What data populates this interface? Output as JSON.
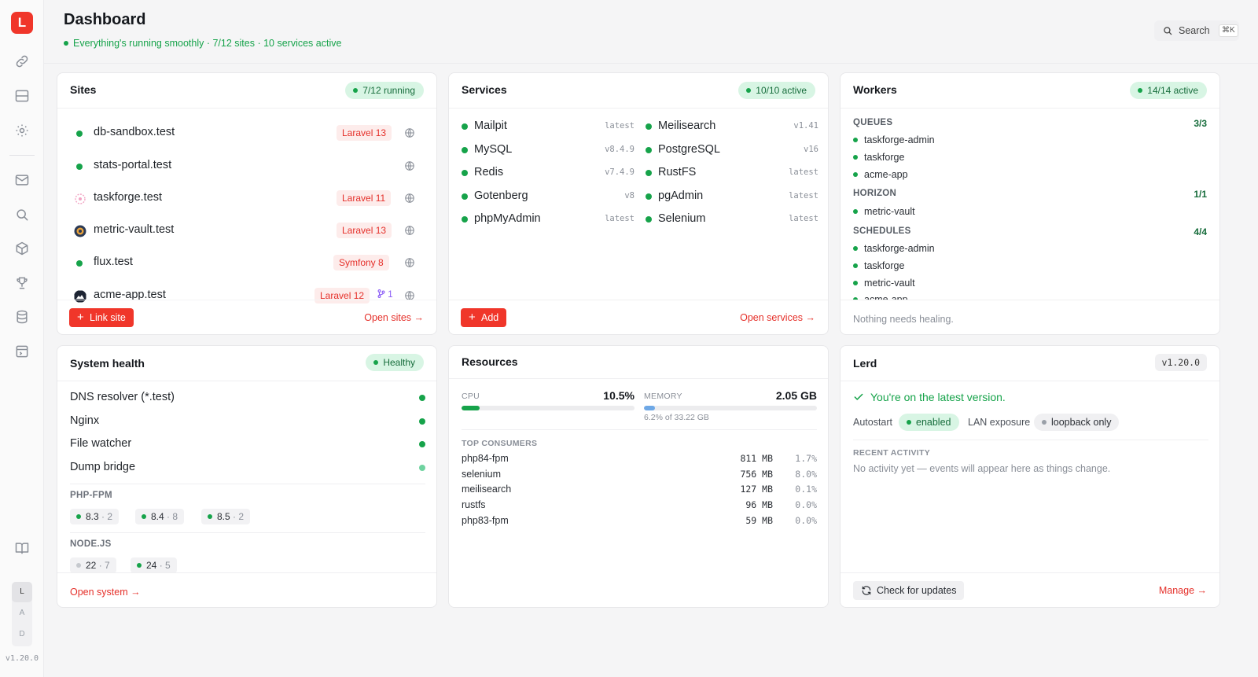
{
  "sidebar": {
    "logo": "L",
    "modes": [
      "L",
      "A",
      "D"
    ],
    "version": "v1.20.0"
  },
  "header": {
    "title": "Dashboard",
    "status": "Everything's running smoothly · 7/12 sites · 10 services active",
    "search_label": "Search",
    "search_shortcut": "⌘K"
  },
  "sites": {
    "title": "Sites",
    "badge": "7/12 running",
    "items": [
      {
        "name": "db-sandbox.test",
        "framework": "Laravel 13",
        "icon": "status-dot"
      },
      {
        "name": "stats-portal.test",
        "framework": "",
        "icon": "status-dot"
      },
      {
        "name": "taskforge.test",
        "framework": "Laravel 11",
        "icon": "taskforge-favicon"
      },
      {
        "name": "metric-vault.test",
        "framework": "Laravel 13",
        "icon": "metric-vault-favicon"
      },
      {
        "name": "flux.test",
        "framework": "Symfony 8",
        "icon": "status-dot"
      },
      {
        "name": "acme-app.test",
        "framework": "Laravel 12",
        "branches": "1",
        "icon": "acme-favicon"
      }
    ],
    "add_label": "Link site",
    "open_label": "Open sites →"
  },
  "services": {
    "title": "Services",
    "badge": "10/10 active",
    "left": [
      {
        "name": "Mailpit",
        "version": "latest"
      },
      {
        "name": "MySQL",
        "version": "v8.4.9"
      },
      {
        "name": "Redis",
        "version": "v7.4.9"
      },
      {
        "name": "Gotenberg",
        "version": "v8"
      },
      {
        "name": "phpMyAdmin",
        "version": "latest"
      }
    ],
    "right": [
      {
        "name": "Meilisearch",
        "version": "v1.41"
      },
      {
        "name": "PostgreSQL",
        "version": "v16"
      },
      {
        "name": "RustFS",
        "version": "latest"
      },
      {
        "name": "pgAdmin",
        "version": "latest"
      },
      {
        "name": "Selenium",
        "version": "latest"
      }
    ],
    "add_label": "Add",
    "open_label": "Open services →"
  },
  "workers": {
    "title": "Workers",
    "badge": "14/14 active",
    "queues": {
      "label": "QUEUES",
      "count": "3/3",
      "items": [
        "taskforge-admin",
        "taskforge",
        "acme-app"
      ]
    },
    "horizon": {
      "label": "HORIZON",
      "count": "1/1",
      "items": [
        "metric-vault"
      ]
    },
    "schedules": {
      "label": "SCHEDULES",
      "count": "4/4",
      "items": [
        "taskforge-admin",
        "taskforge",
        "metric-vault",
        "acme-app"
      ]
    },
    "footer": "Nothing needs healing."
  },
  "health": {
    "title": "System health",
    "badge": "Healthy",
    "checks": [
      {
        "name": "DNS resolver (*.test)",
        "color": "#16a34a"
      },
      {
        "name": "Nginx",
        "color": "#16a34a"
      },
      {
        "name": "File watcher",
        "color": "#16a34a"
      },
      {
        "name": "Dump bridge",
        "color": "#6fd3a0"
      }
    ],
    "php_label": "PHP-FPM",
    "php": [
      {
        "version": "8.3",
        "count": "2"
      },
      {
        "version": "8.4",
        "count": "8"
      },
      {
        "version": "8.5",
        "count": "2"
      }
    ],
    "node_label": "NODE.JS",
    "node": [
      {
        "version": "22",
        "count": "7",
        "active": false
      },
      {
        "version": "24",
        "count": "5",
        "active": true
      }
    ],
    "open_label": "Open system →"
  },
  "resources": {
    "title": "Resources",
    "cpu_label": "CPU",
    "cpu_value": "10.5%",
    "cpu_fraction": 0.105,
    "memory_label": "MEMORY",
    "memory_value": "2.05 GB",
    "memory_sub": "6.2% of 33.22 GB",
    "memory_fraction": 0.062,
    "consumers_label": "TOP CONSUMERS",
    "consumers": [
      {
        "name": "php84-fpm",
        "mem": "811 MB",
        "pct": "1.7%"
      },
      {
        "name": "selenium",
        "mem": "756 MB",
        "pct": "8.0%"
      },
      {
        "name": "meilisearch",
        "mem": "127 MB",
        "pct": "0.1%"
      },
      {
        "name": "rustfs",
        "mem": "96 MB",
        "pct": "0.0%"
      },
      {
        "name": "php83-fpm",
        "mem": "59 MB",
        "pct": "0.0%"
      }
    ],
    "colors": {
      "cpu": "#16a34a",
      "memory": "#6ea8e6"
    }
  },
  "lerd": {
    "title": "Lerd",
    "version": "v1.20.0",
    "status": "You're on the latest version.",
    "autostart_label": "Autostart",
    "autostart_value": "enabled",
    "lan_label": "LAN exposure",
    "lan_value": "loopback only",
    "activity_label": "RECENT ACTIVITY",
    "activity_empty": "No activity yet — events will appear here as things change.",
    "check_label": "Check for updates",
    "manage_label": "Manage →"
  }
}
